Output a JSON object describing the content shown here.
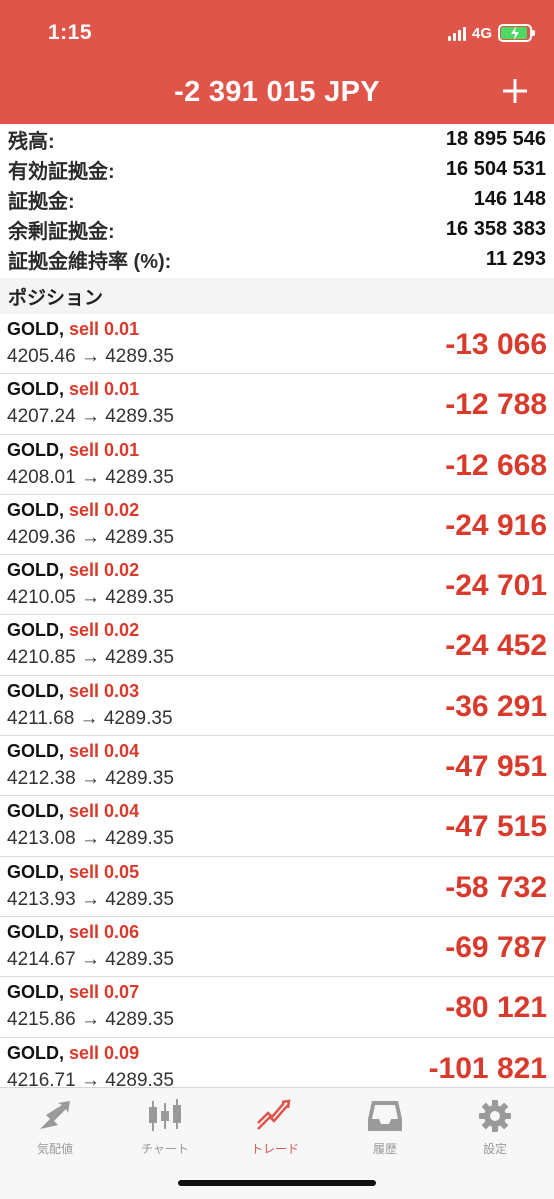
{
  "status_bar": {
    "time": "1:15",
    "network": "4G"
  },
  "header": {
    "balance": "-2 391 015 JPY",
    "add_icon": "plus-icon"
  },
  "account": [
    {
      "label": "残高:",
      "value": "18 895 546"
    },
    {
      "label": "有効証拠金:",
      "value": "16 504 531"
    },
    {
      "label": "証拠金:",
      "value": "146 148"
    },
    {
      "label": "余剰証拠金:",
      "value": "16 358 383"
    },
    {
      "label": "証拠金維持率 (%):",
      "value": "11 293"
    }
  ],
  "positions_title": "ポジション",
  "positions": [
    {
      "symbol": "GOLD,",
      "side": "sell 0.01",
      "prices": "4205.46 → 4289.35",
      "profit": "-13 066"
    },
    {
      "symbol": "GOLD,",
      "side": "sell 0.01",
      "prices": "4207.24 → 4289.35",
      "profit": "-12 788"
    },
    {
      "symbol": "GOLD,",
      "side": "sell 0.01",
      "prices": "4208.01 → 4289.35",
      "profit": "-12 668"
    },
    {
      "symbol": "GOLD,",
      "side": "sell 0.02",
      "prices": "4209.36 → 4289.35",
      "profit": "-24 916"
    },
    {
      "symbol": "GOLD,",
      "side": "sell 0.02",
      "prices": "4210.05 → 4289.35",
      "profit": "-24 701"
    },
    {
      "symbol": "GOLD,",
      "side": "sell 0.02",
      "prices": "4210.85 → 4289.35",
      "profit": "-24 452"
    },
    {
      "symbol": "GOLD,",
      "side": "sell 0.03",
      "prices": "4211.68 → 4289.35",
      "profit": "-36 291"
    },
    {
      "symbol": "GOLD,",
      "side": "sell 0.04",
      "prices": "4212.38 → 4289.35",
      "profit": "-47 951"
    },
    {
      "symbol": "GOLD,",
      "side": "sell 0.04",
      "prices": "4213.08 → 4289.35",
      "profit": "-47 515"
    },
    {
      "symbol": "GOLD,",
      "side": "sell 0.05",
      "prices": "4213.93 → 4289.35",
      "profit": "-58 732"
    },
    {
      "symbol": "GOLD,",
      "side": "sell 0.06",
      "prices": "4214.67 → 4289.35",
      "profit": "-69 787"
    },
    {
      "symbol": "GOLD,",
      "side": "sell 0.07",
      "prices": "4215.86 → 4289.35",
      "profit": "-80 121"
    },
    {
      "symbol": "GOLD,",
      "side": "sell 0.09",
      "prices": "4216.71 → 4289.35",
      "profit": "-101 821"
    }
  ],
  "tabs": [
    {
      "label": "気配値",
      "icon": "quotes-arrow-icon",
      "active": false
    },
    {
      "label": "チャート",
      "icon": "candlestick-chart-icon",
      "active": false
    },
    {
      "label": "トレード",
      "icon": "trade-trend-icon",
      "active": true
    },
    {
      "label": "履歴",
      "icon": "history-inbox-icon",
      "active": false
    },
    {
      "label": "設定",
      "icon": "gear-icon",
      "active": false
    }
  ],
  "colors": {
    "header_bg": "#e0554a",
    "loss_red": "#d93a2b",
    "tab_active": "#e0554a",
    "tab_inactive": "#9a9a9a"
  }
}
